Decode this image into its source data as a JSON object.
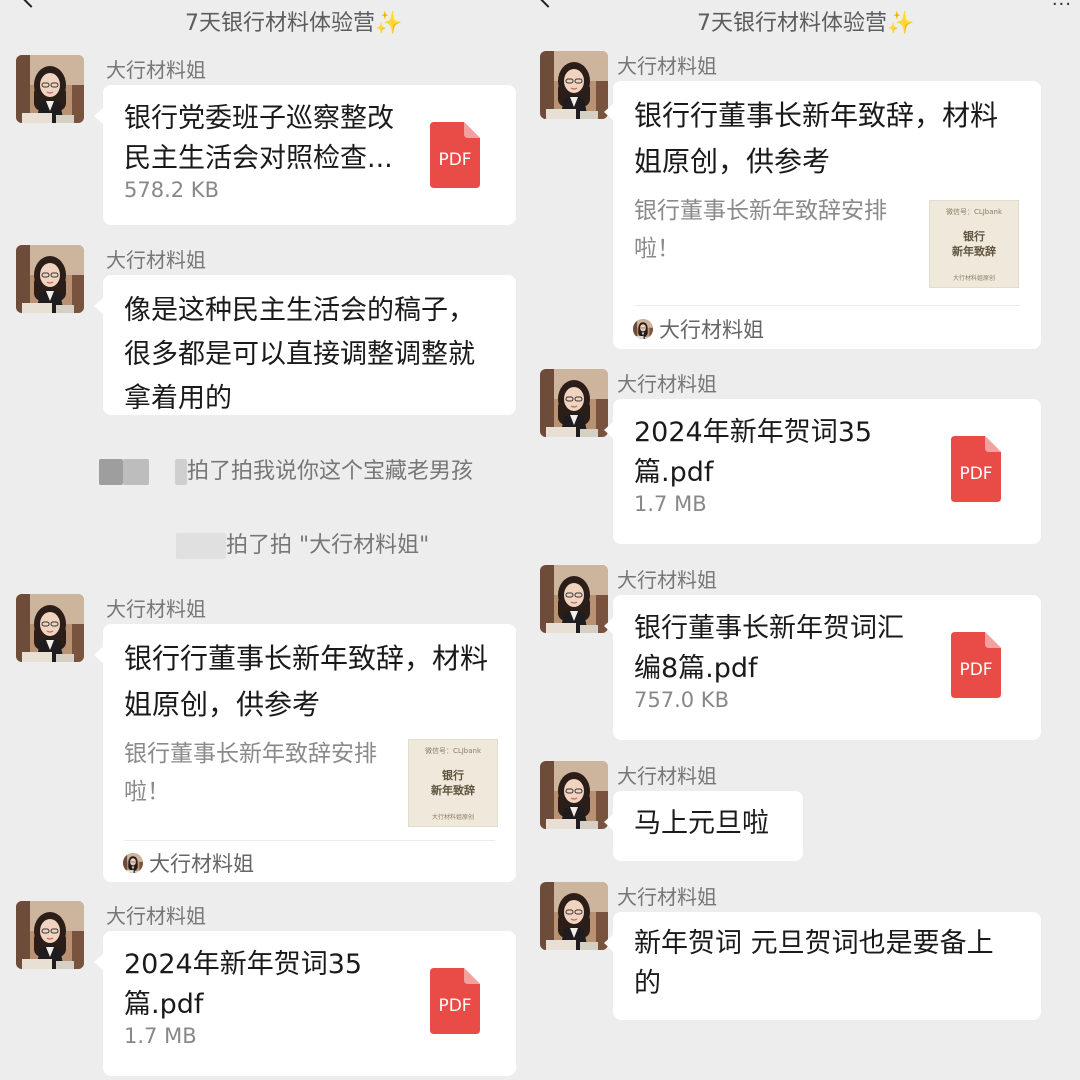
{
  "chat": {
    "title": "7天银行材料体验营",
    "title_sparkle": "✨",
    "sender": "大行材料姐"
  },
  "left": {
    "file1": {
      "name": "银行党委班子巡察整改民主生活会对照检查材料.pdf",
      "size": "578.2 KB",
      "icon_label": "PDF"
    },
    "text1": [
      "像是这种民主生活会的稿子，",
      "很多都是可以直接调整调整就",
      "拿着用的"
    ],
    "pat1": "拍了拍我说你这个宝藏老男孩",
    "pat2": "拍了拍 \"大行材料姐\"",
    "card": {
      "title": [
        "银行行董事长新年致辞，材料",
        "姐原创，供参考"
      ],
      "desc": [
        "银行董事长新年致辞安排",
        "啦！"
      ],
      "thumb_small": "微信号：CLJbank",
      "thumb_main": [
        "银行",
        "新年致辞"
      ],
      "thumb_foot": "大行材料姐原创",
      "source": "大行材料姐"
    },
    "file2": {
      "name": [
        "2024年新年贺词35",
        "篇.pdf"
      ],
      "size": "1.7 MB",
      "icon_label": "PDF"
    }
  },
  "right": {
    "card": {
      "title": [
        "银行行董事长新年致辞，材料",
        "姐原创，供参考"
      ],
      "desc": [
        "银行董事长新年致辞安排",
        "啦！"
      ],
      "thumb_small": "微信号：CLJbank",
      "thumb_main": [
        "银行",
        "新年致辞"
      ],
      "thumb_foot": "大行材料姐原创",
      "source": "大行材料姐"
    },
    "file1": {
      "name": [
        "2024年新年贺词35",
        "篇.pdf"
      ],
      "size": "1.7 MB",
      "icon_label": "PDF"
    },
    "file2": {
      "name": [
        "银行董事长新年贺词汇",
        "编8篇.pdf"
      ],
      "size": "757.0 KB",
      "icon_label": "PDF"
    },
    "text1": "马上元旦啦",
    "text2": [
      "新年贺词 元旦贺词也是要备上",
      "的"
    ]
  },
  "icons": [
    "back-arrow-icon",
    "more-icon",
    "avatar-image",
    "pdf-file-icon"
  ],
  "colors": {
    "background": "#ededed",
    "bubble": "#ffffff",
    "pdf_red": "#e94b46",
    "muted_text": "#888888"
  }
}
